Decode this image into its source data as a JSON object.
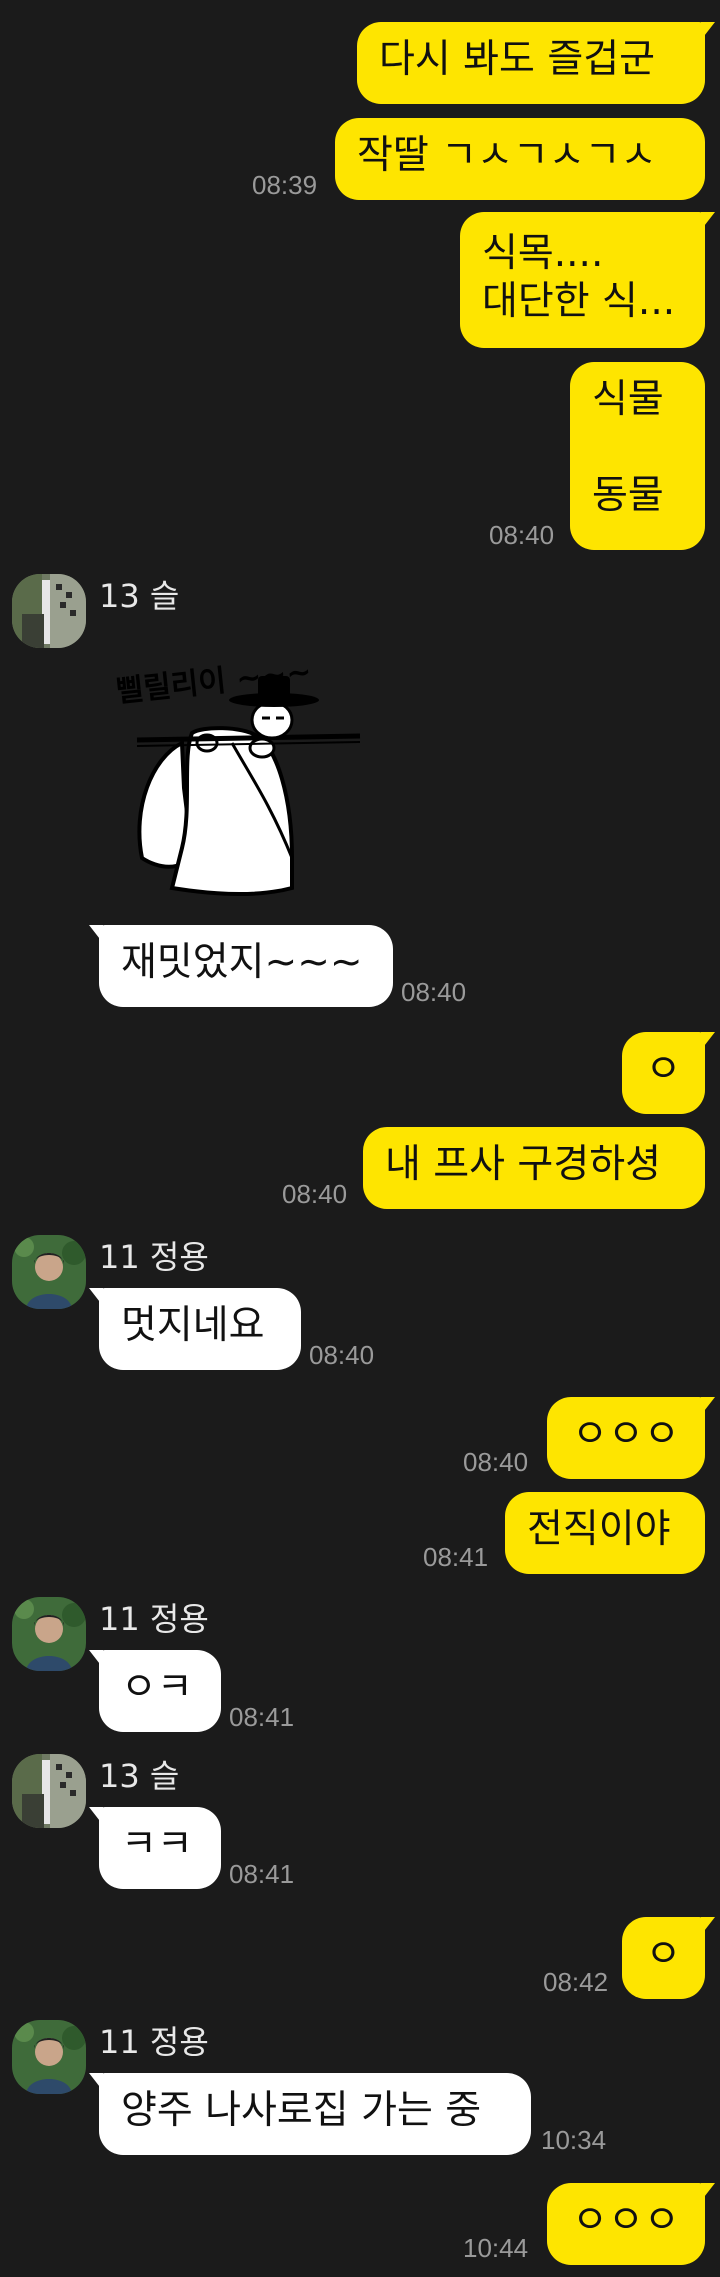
{
  "messages": [
    {
      "text": "다시 봐도 즐겁군"
    },
    {
      "text": "작딸 ㄱㅅㄱㅅㄱㅅ",
      "time": "08:39"
    },
    {
      "text": "식목....\n대단한 식..."
    },
    {
      "text": "식물\n\n동물",
      "time": "08:40"
    },
    {
      "sender": "13 슬",
      "sticker_text": "삘릴리이 ~~~"
    },
    {
      "text": "재밋었지~~~",
      "time": "08:40"
    },
    {
      "text": "ㅇ"
    },
    {
      "text": "내 프사 구경하셩",
      "time": "08:40"
    },
    {
      "sender": "11 정용",
      "text": "멋지네요",
      "time": "08:40"
    },
    {
      "text": "ㅇㅇㅇ",
      "time": "08:40"
    },
    {
      "text": "전직이야",
      "time": "08:41"
    },
    {
      "sender": "11 정용",
      "text": "ㅇㅋ",
      "time": "08:41"
    },
    {
      "sender": "13 슬",
      "text": "ㅋㅋ",
      "time": "08:41"
    },
    {
      "text": "ㅇ",
      "time": "08:42"
    },
    {
      "sender": "11 정용",
      "text": "양주 나사로집 가는 중",
      "time": "10:34"
    },
    {
      "text": "ㅇㅇㅇ",
      "time": "10:44"
    }
  ],
  "colors": {
    "background": "#1b1b1b",
    "my_bubble": "#fee500",
    "other_bubble": "#ffffff",
    "timestamp": "#9a9a9a"
  }
}
